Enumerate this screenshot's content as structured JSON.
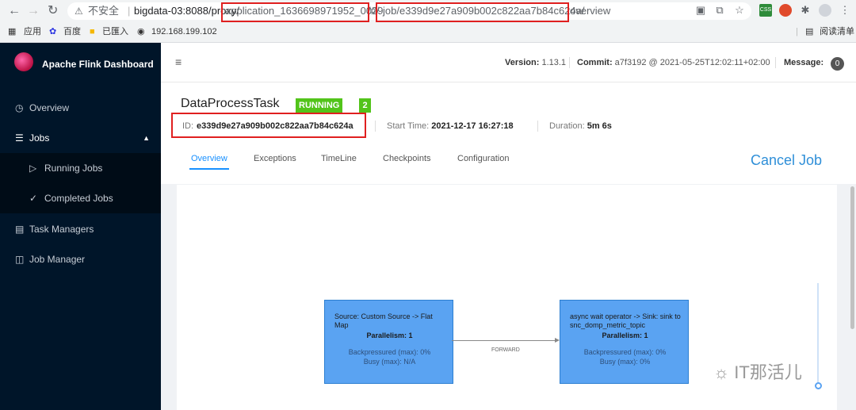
{
  "browser": {
    "insecure_label": "不安全",
    "url_host": "bigdata-03:8088/proxy/",
    "url_part1": "application_1636698971952_0029",
    "url_sep": "/#/",
    "url_part2": "job/e339d9e27a909b002c822aa7b84c624a/",
    "url_part3": "overview",
    "bookmarks": [
      "应用",
      "百度",
      "已匯入",
      "192.168.199.102"
    ],
    "reading_list": "阅读清单"
  },
  "sidebar": {
    "title": "Apache Flink Dashboard",
    "items": [
      {
        "label": "Overview",
        "icon": "dashboard-icon"
      },
      {
        "label": "Jobs",
        "icon": "list-icon"
      },
      {
        "label": "Running Jobs",
        "icon": "play-circle-icon"
      },
      {
        "label": "Completed Jobs",
        "icon": "check-circle-icon"
      },
      {
        "label": "Task Managers",
        "icon": "calendar-icon"
      },
      {
        "label": "Job Manager",
        "icon": "cluster-icon"
      }
    ]
  },
  "topbar": {
    "version_label": "Version:",
    "version": "1.13.1",
    "commit_label": "Commit:",
    "commit": "a7f3192 @ 2021-05-25T12:02:11+02:00",
    "message_label": "Message:",
    "message_count": "0"
  },
  "job": {
    "name": "DataProcessTask",
    "status": "RUNNING",
    "task_count": "2",
    "id_label": "ID:",
    "id": "e339d9e27a909b002c822aa7b84c624a",
    "start_label": "Start Time:",
    "start_time": "2021-12-17 16:27:18",
    "duration_label": "Duration:",
    "duration": "5m 6s",
    "cancel_label": "Cancel Job"
  },
  "tabs": [
    "Overview",
    "Exceptions",
    "TimeLine",
    "Checkpoints",
    "Configuration"
  ],
  "graph": {
    "nodes": [
      {
        "name": "Source: Custom Source -> Flat Map",
        "parallelism": "Parallelism: 1",
        "backpressure": "Backpressured (max): 0%",
        "busy": "Busy (max): N/A"
      },
      {
        "name": "async wait operator -> Sink: sink to snc_domp_metric_topic",
        "parallelism": "Parallelism: 1",
        "backpressure": "Backpressured (max): 0%",
        "busy": "Busy (max): 0%"
      }
    ],
    "edge_label": "FORWARD"
  },
  "watermark": "IT那活儿"
}
